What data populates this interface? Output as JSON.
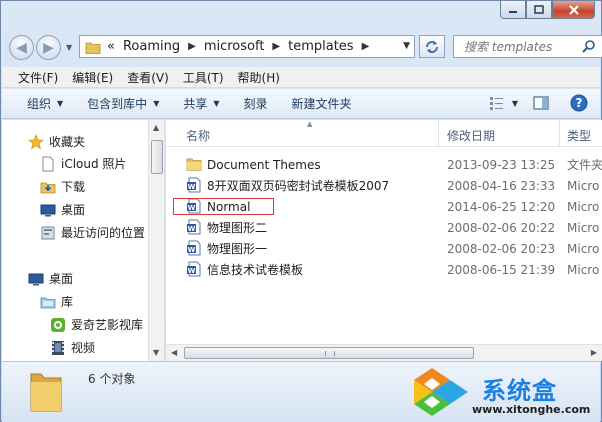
{
  "address": {
    "overflow": "«",
    "path": [
      "Roaming",
      "microsoft",
      "templates"
    ]
  },
  "search": {
    "placeholder": "搜索 templates"
  },
  "menu": [
    "文件(F)",
    "编辑(E)",
    "查看(V)",
    "工具(T)",
    "帮助(H)"
  ],
  "commands": {
    "organize": "组织",
    "include": "包含到库中",
    "share": "共享",
    "burn": "刻录",
    "newfolder": "新建文件夹"
  },
  "nav": {
    "favorites": "收藏夹",
    "icloud": "iCloud 照片",
    "downloads": "下载",
    "desktop_fav": "桌面",
    "recent": "最近访问的位置",
    "desktop": "桌面",
    "library": "库",
    "iqiyi": "爱奇艺影视库",
    "video": "视频"
  },
  "columns": {
    "name": "名称",
    "date": "修改日期",
    "type": "类型"
  },
  "files": [
    {
      "name": "Document Themes",
      "date": "2013-09-23 13:25",
      "type": "文件夹",
      "icon": "folder-icon"
    },
    {
      "name": "8开双面双页码密封试卷模板2007",
      "date": "2008-04-16 23:33",
      "type": "Micro",
      "icon": "word-doc-icon"
    },
    {
      "name": "Normal",
      "date": "2014-06-25 12:20",
      "type": "Micro",
      "icon": "word-doc-icon"
    },
    {
      "name": "物理图形二",
      "date": "2008-02-06 20:22",
      "type": "Micro",
      "icon": "word-doc-icon"
    },
    {
      "name": "物理图形一",
      "date": "2008-02-06 20:23",
      "type": "Micro",
      "icon": "word-doc-icon"
    },
    {
      "name": "信息技术试卷模板",
      "date": "2008-06-15 21:39",
      "type": "Micro",
      "icon": "word-doc-icon"
    }
  ],
  "details": {
    "count": "6 个对象"
  },
  "brand": {
    "title": "系统盒",
    "url": "www.xitonghe.com"
  },
  "colors": {
    "accent": "#1b7fe0",
    "highlight_box": "#d83a3a",
    "folder": "#e8c25a"
  }
}
